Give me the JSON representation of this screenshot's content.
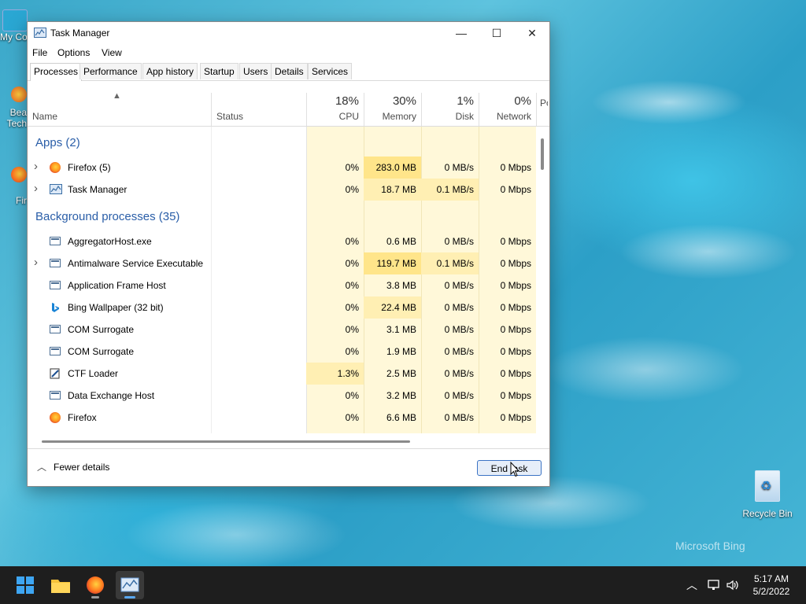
{
  "desktop": {
    "icons": [
      {
        "label": "My Co"
      },
      {
        "label": "Bea Tech"
      },
      {
        "label": "Fir"
      },
      {
        "label": "Recycle Bin"
      }
    ],
    "watermark": "Microsoft Bing"
  },
  "window": {
    "title": "Task Manager",
    "controls": {
      "minimize": "—",
      "maximize": "☐",
      "close": "✕"
    }
  },
  "menu": [
    "File",
    "Options",
    "View"
  ],
  "tabs": [
    "Processes",
    "Performance",
    "App history",
    "Startup",
    "Users",
    "Details",
    "Services"
  ],
  "active_tab": "Processes",
  "header": {
    "name": "Name",
    "status": "Status",
    "cpu": {
      "pct": "18%",
      "label": "CPU"
    },
    "memory": {
      "pct": "30%",
      "label": "Memory"
    },
    "disk": {
      "pct": "1%",
      "label": "Disk"
    },
    "network": {
      "pct": "0%",
      "label": "Network"
    },
    "power": "Po"
  },
  "groups": {
    "apps": "Apps (2)",
    "background": "Background processes (35)"
  },
  "apps": [
    {
      "name": "Firefox (5)",
      "icon": "firefox-icon",
      "expandable": true,
      "cpu": "0%",
      "memory": "283.0 MB",
      "disk": "0 MB/s",
      "network": "0 Mbps"
    },
    {
      "name": "Task Manager",
      "icon": "task-manager-icon",
      "expandable": true,
      "cpu": "0%",
      "memory": "18.7 MB",
      "disk": "0.1 MB/s",
      "network": "0 Mbps"
    }
  ],
  "background": [
    {
      "name": "AggregatorHost.exe",
      "icon": "process-icon",
      "expandable": false,
      "cpu": "0%",
      "memory": "0.6 MB",
      "disk": "0 MB/s",
      "network": "0 Mbps"
    },
    {
      "name": "Antimalware Service Executable",
      "icon": "process-icon",
      "expandable": true,
      "cpu": "0%",
      "memory": "119.7 MB",
      "disk": "0.1 MB/s",
      "network": "0 Mbps"
    },
    {
      "name": "Application Frame Host",
      "icon": "process-icon",
      "expandable": false,
      "cpu": "0%",
      "memory": "3.8 MB",
      "disk": "0 MB/s",
      "network": "0 Mbps"
    },
    {
      "name": "Bing Wallpaper (32 bit)",
      "icon": "bing-icon",
      "expandable": false,
      "cpu": "0%",
      "memory": "22.4 MB",
      "disk": "0 MB/s",
      "network": "0 Mbps"
    },
    {
      "name": "COM Surrogate",
      "icon": "process-icon",
      "expandable": false,
      "cpu": "0%",
      "memory": "3.1 MB",
      "disk": "0 MB/s",
      "network": "0 Mbps"
    },
    {
      "name": "COM Surrogate",
      "icon": "process-icon",
      "expandable": false,
      "cpu": "0%",
      "memory": "1.9 MB",
      "disk": "0 MB/s",
      "network": "0 Mbps"
    },
    {
      "name": "CTF Loader",
      "icon": "ctf-loader-icon",
      "expandable": false,
      "cpu": "1.3%",
      "memory": "2.5 MB",
      "disk": "0 MB/s",
      "network": "0 Mbps"
    },
    {
      "name": "Data Exchange Host",
      "icon": "process-icon",
      "expandable": false,
      "cpu": "0%",
      "memory": "3.2 MB",
      "disk": "0 MB/s",
      "network": "0 Mbps"
    },
    {
      "name": "Firefox",
      "icon": "firefox-icon",
      "expandable": false,
      "cpu": "0%",
      "memory": "6.6 MB",
      "disk": "0 MB/s",
      "network": "0 Mbps"
    }
  ],
  "footer": {
    "fewer_details": "Fewer details",
    "end_task": "End task"
  },
  "taskbar": {
    "apps": [
      "start-icon",
      "file-explorer-icon",
      "firefox-icon",
      "task-manager-icon"
    ],
    "tray": [
      "chevron-up-icon",
      "network-icon",
      "volume-icon"
    ],
    "time": "5:17 AM",
    "date": "5/2/2022"
  },
  "colors": {
    "heat_light": "#fff8d9",
    "heat_mid": "#ffefb3",
    "heat_strong": "#ffe58a",
    "accent": "#2a5ea8",
    "taskbar": "#1e1e1e"
  }
}
